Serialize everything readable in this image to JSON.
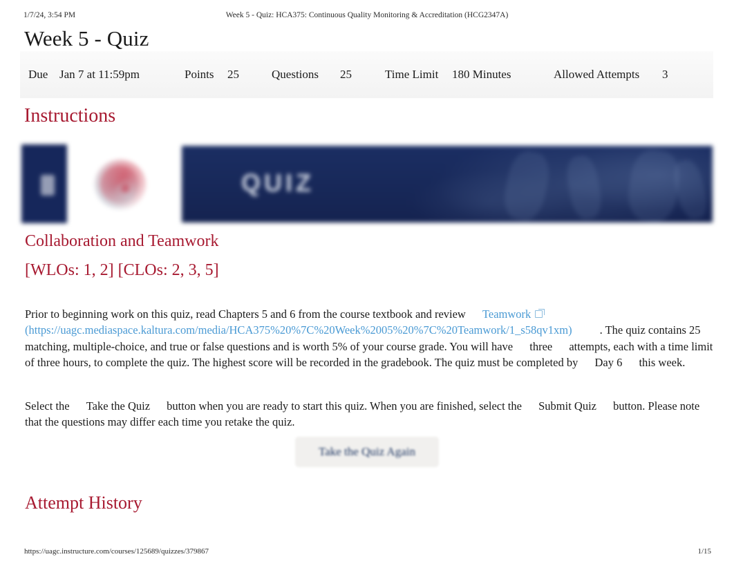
{
  "print_header": {
    "date": "1/7/24, 3:54 PM",
    "title": "Week 5 - Quiz: HCA375: Continuous Quality Monitoring & Accreditation (HCG2347A)"
  },
  "page_title": "Week 5 - Quiz",
  "meta": {
    "due_label": "Due",
    "due_value": "Jan 7 at 11:59pm",
    "points_label": "Points",
    "points_value": "25",
    "questions_label": "Questions",
    "questions_value": "25",
    "time_limit_label": "Time Limit",
    "time_limit_value": "180 Minutes",
    "attempts_label": "Allowed Attempts",
    "attempts_value": "3"
  },
  "headings": {
    "instructions": "Instructions",
    "collaboration": "Collaboration and Teamwork",
    "wlos_clos": "[WLOs: 1, 2] [CLOs: 2, 3, 5]",
    "attempt_history": "Attempt History"
  },
  "banner": {
    "word": "QUIZ",
    "navy": "#16275b",
    "logo_red": "#c9263c"
  },
  "paragraph_1": {
    "seg_1": "Prior to beginning work on this quiz, read Chapters 5 and 6 from the course textbook and review ",
    "link_text": "Teamwork",
    "url_text": "(https://uagc.mediaspace.kaltura.com/media/HCA375%20%7C%20Week%2005%20%7C%20Teamwork/1_s58qv1xm)",
    "seg_2": ". The quiz contains 25 matching, multiple-choice, and true or false questions and is worth 5% of your course grade. You will have ",
    "bold_1": "three",
    "seg_3": " attempts, each with a time limit of three hours, to complete the quiz. The highest score will be recorded in the gradebook. The quiz must be completed by ",
    "bold_2": "Day 6",
    "seg_4": " this week."
  },
  "paragraph_2": {
    "seg_1": "Select the ",
    "bold_1": "Take the Quiz",
    "seg_2": " button when you are ready to start this quiz. When you are finished, select the ",
    "bold_2": "Submit Quiz",
    "seg_3": " button. Please note that the questions may differ each time you retake the quiz."
  },
  "take_quiz_button": "Take the Quiz Again",
  "print_footer": {
    "url": "https://uagc.instructure.com/courses/125689/quizzes/379867",
    "page": "1/15"
  },
  "colors": {
    "heading_crimson": "#a71930",
    "link_blue": "#4a9ad4",
    "button_text": "#203864"
  }
}
